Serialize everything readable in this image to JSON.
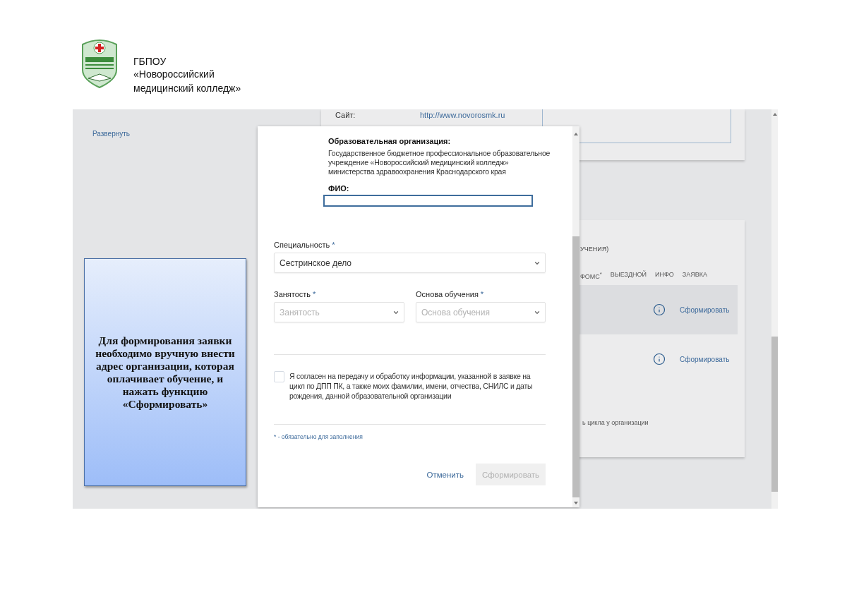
{
  "header": {
    "lines": [
      "ГБПОУ",
      "«Новороссийский",
      "медицинский колледж»"
    ]
  },
  "sidebar": {
    "expand_link": "Развернуть"
  },
  "org_card": {
    "label": "Сайт:",
    "link": "http://www.novorosmk.ru"
  },
  "courses_card": {
    "caption": "УЧЕНИЯ)",
    "columns": [
      "ФОМС$^{*}$",
      "ВЫЕЗДНОЙ",
      "ИНФО",
      "ЗАЯВКА"
    ],
    "rows": [
      {
        "selected": true,
        "action": "Сформировать"
      },
      {
        "selected": false,
        "action": "Сформировать"
      }
    ],
    "footer": "ь цикла у организации"
  },
  "modal": {
    "org_label": "Образовательная организация:",
    "org_name": "Государственное бюджетное профессиональное образовательное учреждение «Новороссийский медицинский колледж» министерства здравоохранения Краснодарского края",
    "fio_label": "ФИО:",
    "fio_focused": true,
    "fields": [
      {
        "label": "Специальность",
        "required_mark": "*",
        "value": "Сестринское дело"
      },
      {
        "label": "Занятость",
        "required_mark": "*",
        "placeholder": "Занятость"
      },
      {
        "label": "Основа обучения",
        "required_mark": "*",
        "placeholder": "Основа обучения"
      }
    ],
    "consent": {
      "checked": false,
      "text": "Я согласен на передачу и обработку информации, указанной в заявке на цикл по ДПП ПК, а также моих фамилии, имени, отчества, СНИЛС и даты рождения, данной образовательной организации"
    },
    "note": "* - обязательно для заполнения",
    "buttons": [
      {
        "kind": "link",
        "label": "Отменить",
        "disabled": false
      },
      {
        "kind": "primary",
        "label": "Сформировать",
        "disabled": true
      }
    ]
  },
  "callout": {
    "text": "Для формирования заявки необходимо вручную внести адрес организации, которая оплачивает обучение, и нажать функцию «Сформировать»"
  }
}
